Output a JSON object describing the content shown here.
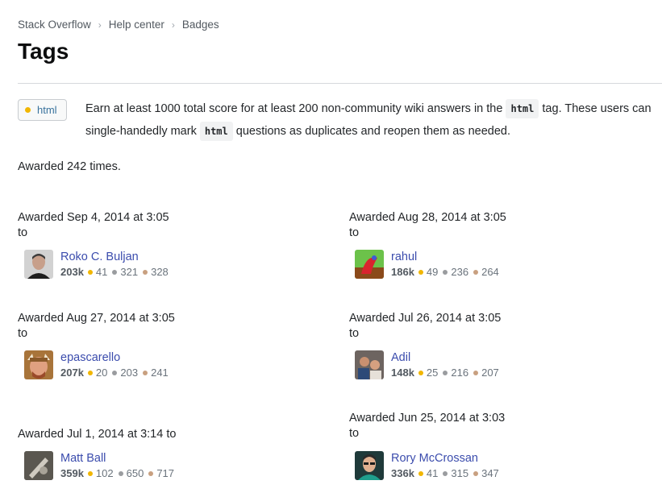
{
  "breadcrumb": [
    "Stack Overflow",
    "Help center",
    "Badges"
  ],
  "page_title": "Tags",
  "badge": {
    "name": "html",
    "color": "#f1b600"
  },
  "description": {
    "part1": "Earn at least 1000 total score for at least 200 non-community wiki answers in the",
    "tag": "html",
    "part2": "tag. These users can single-handedly mark",
    "part3": "questions as duplicates and reopen them as needed."
  },
  "awarded_count": "Awarded 242 times.",
  "awards": [
    {
      "when": "Awarded Sep 4, 2014 at 3:05",
      "to": "to",
      "user": "Roko C. Buljan",
      "rep": "203k",
      "gold": "41",
      "silver": "321",
      "bronze": "328"
    },
    {
      "when": "Awarded Aug 28, 2014 at 3:05",
      "to": "to",
      "user": "rahul",
      "rep": "186k",
      "gold": "49",
      "silver": "236",
      "bronze": "264"
    },
    {
      "when": "Awarded Aug 27, 2014 at 3:05",
      "to": "to",
      "user": "epascarello",
      "rep": "207k",
      "gold": "20",
      "silver": "203",
      "bronze": "241"
    },
    {
      "when": "Awarded Jul 26, 2014 at 3:05",
      "to": "to",
      "user": "Adil",
      "rep": "148k",
      "gold": "25",
      "silver": "216",
      "bronze": "207"
    },
    {
      "when": "Awarded Jul 1, 2014 at 3:14 to",
      "to": "",
      "user": "Matt Ball",
      "rep": "359k",
      "gold": "102",
      "silver": "650",
      "bronze": "717"
    },
    {
      "when": "Awarded Jun 25, 2014 at 3:03",
      "to": "to",
      "user": "Rory McCrossan",
      "rep": "336k",
      "gold": "41",
      "silver": "315",
      "bronze": "347"
    }
  ]
}
